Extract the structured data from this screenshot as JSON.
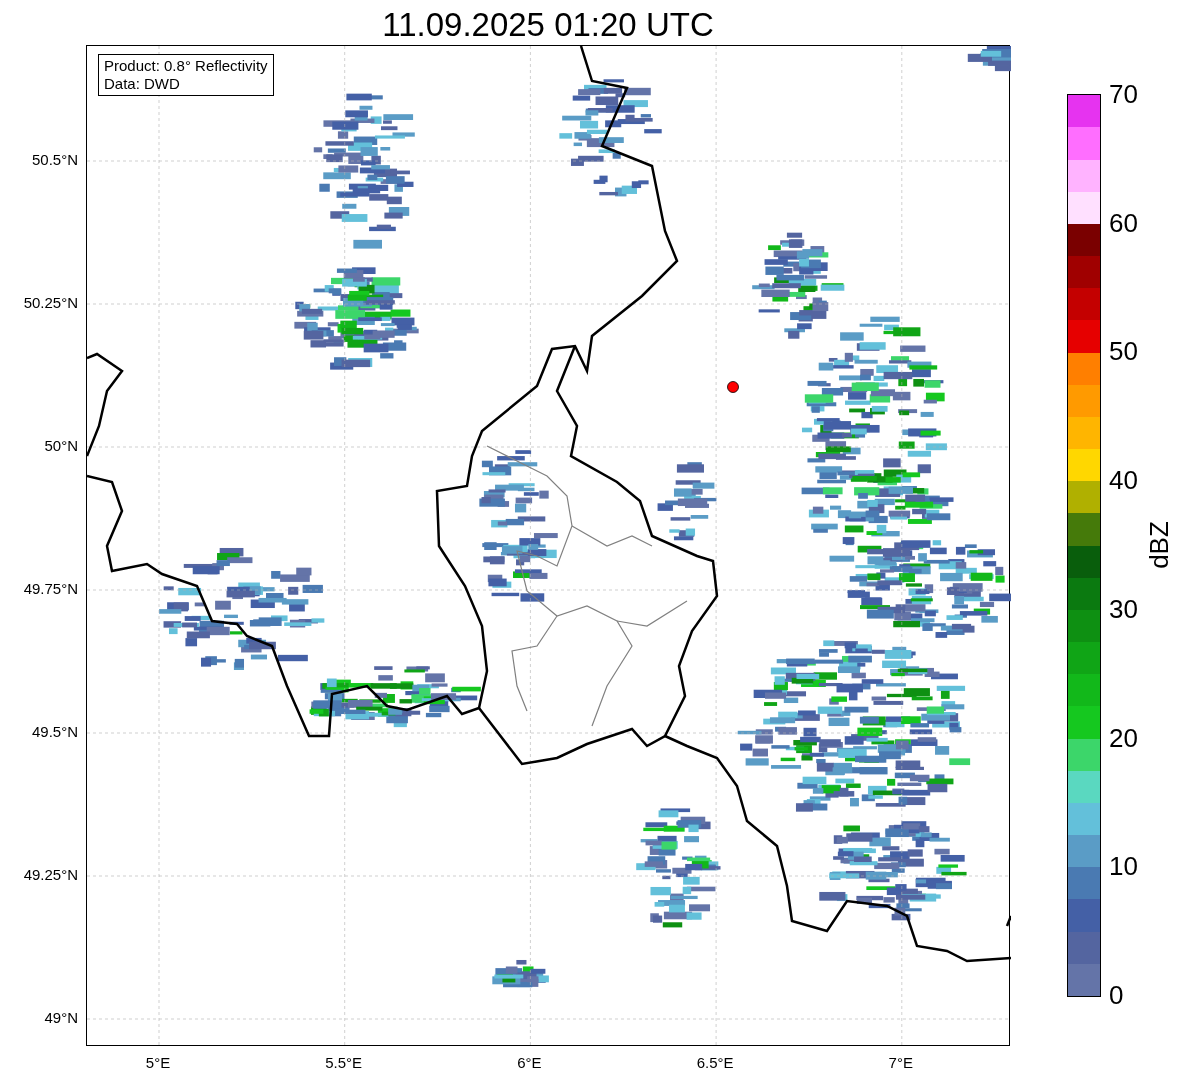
{
  "figure": {
    "title": "11.09.2025 01:20 UTC"
  },
  "map": {
    "info_lines": [
      "Product: 0.8° Reflectivity",
      "Data: DWD"
    ],
    "lat_ticks": [
      "50.5°N",
      "50.25°N",
      "50°N",
      "49.75°N",
      "49.5°N",
      "49.25°N",
      "49°N"
    ],
    "lon_ticks": [
      "5°E",
      "5.5°E",
      "6°E",
      "6.5°E",
      "7°E"
    ]
  },
  "colorbar": {
    "label": "dBZ",
    "ticks": [
      "70",
      "60",
      "50",
      "40",
      "30",
      "20",
      "10",
      "0"
    ],
    "bands": [
      {
        "color": "#6474a8"
      },
      {
        "color": "#5465a0"
      },
      {
        "color": "#4460a6"
      },
      {
        "color": "#4a7ab2"
      },
      {
        "color": "#5a9cc6"
      },
      {
        "color": "#63c0da"
      },
      {
        "color": "#5ad8c0"
      },
      {
        "color": "#3cd66a"
      },
      {
        "color": "#15c81f"
      },
      {
        "color": "#12b81a"
      },
      {
        "color": "#10a516"
      },
      {
        "color": "#0e9012"
      },
      {
        "color": "#0b7a10"
      },
      {
        "color": "#095e0c"
      },
      {
        "color": "#457a0a"
      },
      {
        "color": "#b0b000"
      },
      {
        "color": "#ffd700"
      },
      {
        "color": "#ffb500"
      },
      {
        "color": "#ff9a00"
      },
      {
        "color": "#ff7f00"
      },
      {
        "color": "#e60000"
      },
      {
        "color": "#c40000"
      },
      {
        "color": "#a00000"
      },
      {
        "color": "#7a0000"
      },
      {
        "color": "#ffe0ff"
      },
      {
        "color": "#ffb3ff"
      },
      {
        "color": "#ff6eff"
      },
      {
        "color": "#e633f0"
      }
    ]
  }
}
